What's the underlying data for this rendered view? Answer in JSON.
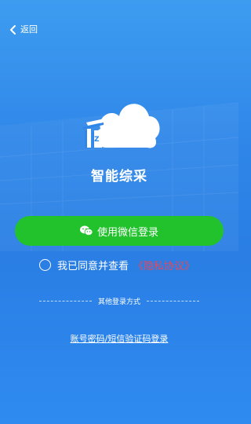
{
  "header": {
    "back_label": "返回",
    "back_icon": "chevron-left-icon"
  },
  "app": {
    "name": "智能综采",
    "logo_icon": "cloud-logo-icon"
  },
  "wechat_login": {
    "label": "使用微信登录",
    "icon": "wechat-icon",
    "color": "#21c22b"
  },
  "agreement": {
    "text": "我已同意并查看",
    "link": "《隐私协议》",
    "link_color": "#e8475a",
    "checked": false
  },
  "other_methods": {
    "label": "其他登录方式"
  },
  "alt_login": {
    "label": "账号密码/短信验证码登录"
  },
  "colors": {
    "background": "#2f86e8"
  }
}
